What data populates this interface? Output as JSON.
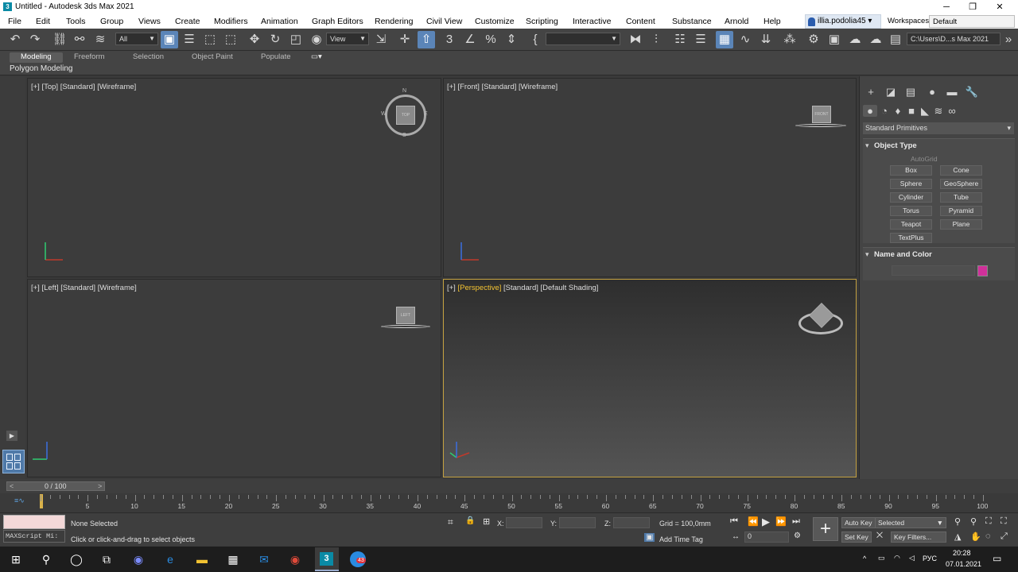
{
  "window": {
    "title": "Untitled - Autodesk 3ds Max 2021",
    "minimize": "─",
    "maximize": "❐",
    "close": "✕"
  },
  "menu": [
    "File",
    "Edit",
    "Tools",
    "Group",
    "Views",
    "Create",
    "Modifiers",
    "Animation",
    "Graph Editors",
    "Rendering",
    "Civil View",
    "Customize",
    "Scripting",
    "Interactive",
    "Content",
    "Substance",
    "Arnold",
    "Help"
  ],
  "user": {
    "name": "illia.podolia45 ▾",
    "workspaces_label": "Workspaces:",
    "workspace": "Default"
  },
  "toolbar": {
    "filter_select": "All",
    "ref_coord": "View",
    "named_sel": "",
    "path": "C:\\Users\\D...s Max 2021"
  },
  "ribbon": {
    "tabs": [
      "Modeling",
      "Freeform",
      "Selection",
      "Object Paint",
      "Populate"
    ],
    "active": "Modeling",
    "sub": "Polygon Modeling"
  },
  "viewports": {
    "top": {
      "plus": "[+]",
      "view": "[Top]",
      "shading": "[Standard]",
      "mode": "[Wireframe]",
      "cube": "TOP",
      "compass": [
        "N",
        "W",
        "E",
        "S"
      ]
    },
    "front": {
      "plus": "[+]",
      "view": "[Front]",
      "shading": "[Standard]",
      "mode": "[Wireframe]",
      "cube": "FRONT"
    },
    "left": {
      "plus": "[+]",
      "view": "[Left]",
      "shading": "[Standard]",
      "mode": "[Wireframe]",
      "cube": "LEFT"
    },
    "persp": {
      "plus": "[+]",
      "view": "[Perspective]",
      "shading": "[Standard]",
      "mode": "[Default Shading]"
    }
  },
  "command_panel": {
    "category": "Standard Primitives",
    "object_type": "Object Type",
    "autogrid": "AutoGrid",
    "buttons": [
      "Box",
      "Cone",
      "Sphere",
      "GeoSphere",
      "Cylinder",
      "Tube",
      "Torus",
      "Pyramid",
      "Teapot",
      "Plane",
      "TextPlus"
    ],
    "name_color": "Name and Color",
    "color": "#d0309a"
  },
  "timeline": {
    "frame": "0 / 100",
    "ticks": [
      "5",
      "10",
      "15",
      "20",
      "25",
      "30",
      "35",
      "40",
      "45",
      "50",
      "55",
      "60",
      "65",
      "70",
      "75",
      "80",
      "85",
      "90",
      "95",
      "100"
    ]
  },
  "status": {
    "maxscript": "MAXScript Mi:",
    "selection": "None Selected",
    "prompt": "Click or click-and-drag to select objects",
    "x_label": "X:",
    "y_label": "Y:",
    "z_label": "Z:",
    "grid": "Grid = 100,0mm",
    "add_time_tag": "Add Time Tag",
    "auto_key": "Auto Key",
    "set_key": "Set Key",
    "selected": "Selected",
    "key_filters": "Key Filters...",
    "frame_value": "0"
  },
  "taskbar": {
    "lang": "РУС",
    "time": "20:28",
    "date": "07.01.2021",
    "badge": "43"
  }
}
